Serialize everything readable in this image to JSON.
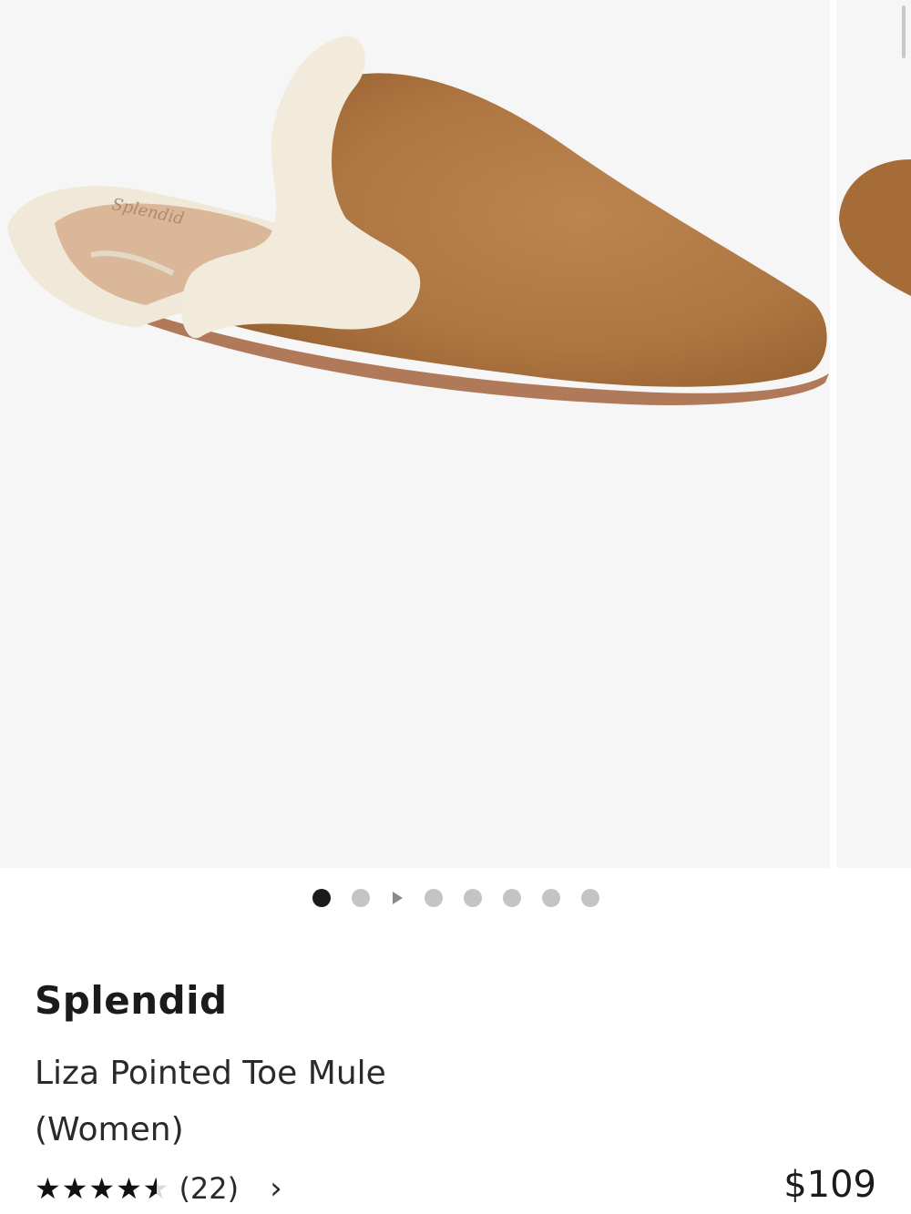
{
  "product": {
    "brand": "Splendid",
    "title_line1": "Liza Pointed Toe Mule",
    "title_line2": "(Women)",
    "rating": 4.5,
    "rating_max": 5,
    "review_count": "(22)",
    "price": "$109"
  },
  "gallery": {
    "image_count": 8,
    "active_index": 0,
    "video_index": 2,
    "insole_logo": "Splendid"
  },
  "icons": {
    "stars": "star-rating-icon",
    "chevron": "chevron-right-icon",
    "video": "play-icon"
  },
  "colors": {
    "suede": "#b07840",
    "fur": "#f2ebdc",
    "active_dot": "#1b1b1b",
    "inactive_dot": "#c4c4c4"
  }
}
